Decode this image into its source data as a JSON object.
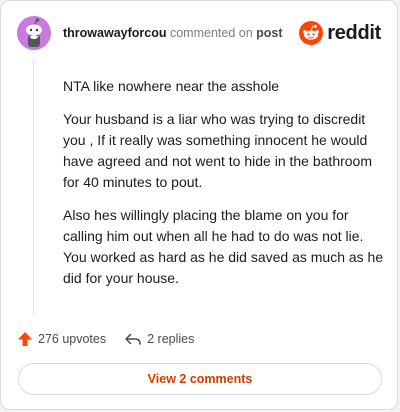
{
  "comment": {
    "username": "throwawayforcou",
    "action_text": "commented on",
    "target_link": "post",
    "paragraphs": [
      "NTA like nowhere near the asshole",
      "Your husband is a liar who was trying to discredit you , If it really was something innocent he would have agreed and not went to hide in the bathroom for 40 minutes to pout.",
      "Also hes willingly placing the blame on you for calling him out when all he had to do was not lie. You worked as hard as he did saved as much as he did for your house."
    ],
    "avatar_icon": "snoo-avatar-icon",
    "avatar_color": "#c87adf"
  },
  "brand": {
    "wordmark": "reddit",
    "icon": "reddit-logo-icon",
    "color": "#ff4500"
  },
  "actions": {
    "upvotes_label": "276 upvotes",
    "upvote_icon": "upvote-arrow-icon",
    "upvote_color": "#ff4500",
    "replies_label": "2 replies",
    "reply_icon": "reply-arrow-icon"
  },
  "footer": {
    "view_comments_label": "View 2 comments",
    "accent_color": "#d93900"
  }
}
